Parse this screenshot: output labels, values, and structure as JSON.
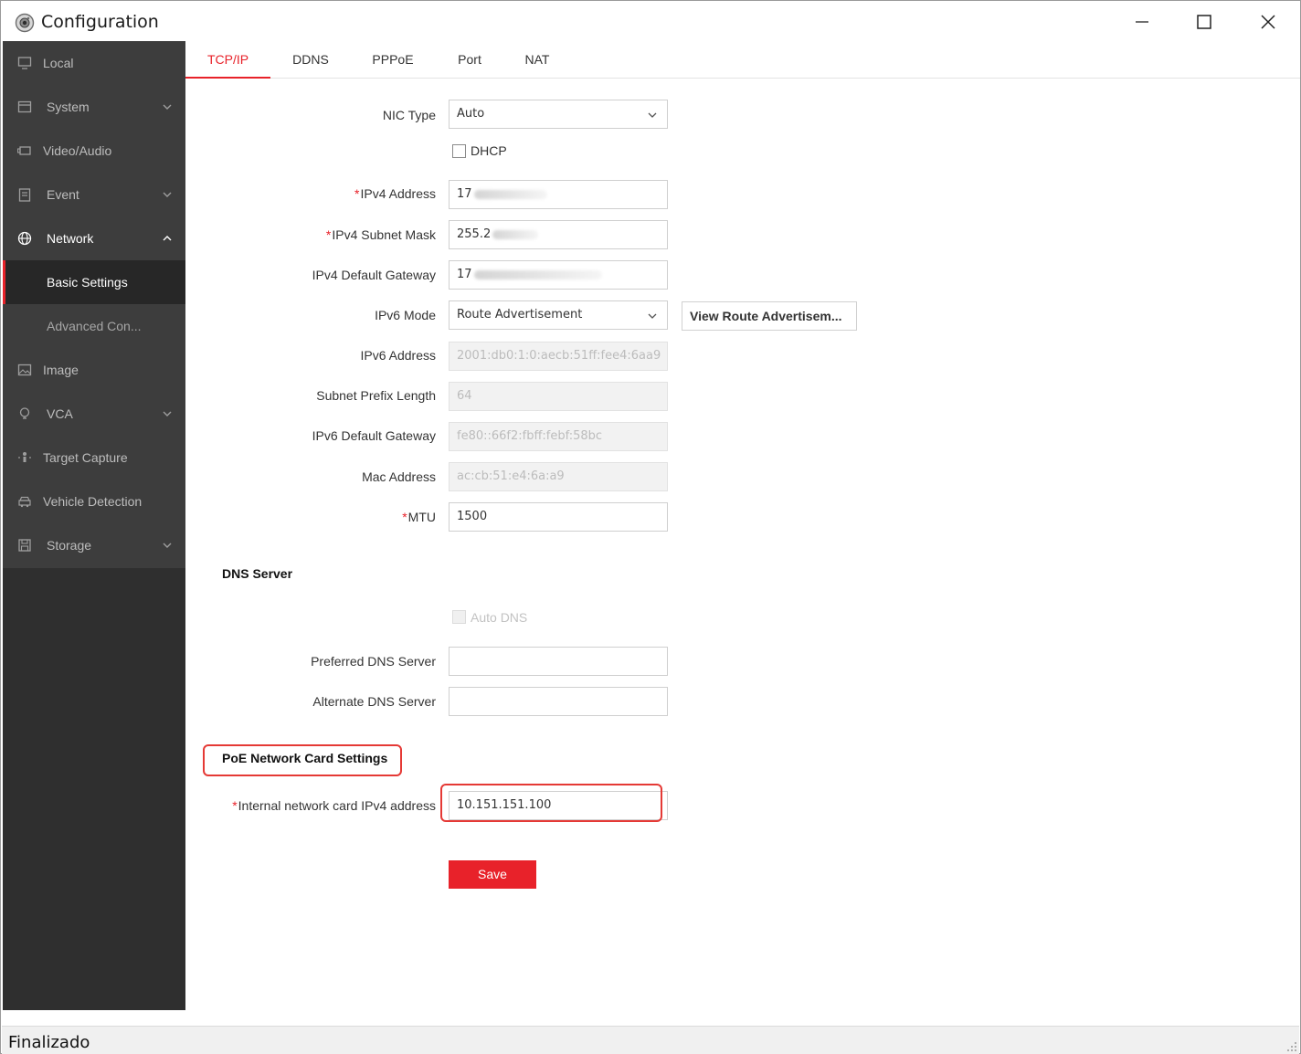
{
  "window": {
    "title": "Configuration"
  },
  "sidebar": {
    "items": [
      {
        "label": "Local",
        "icon": "monitor-icon"
      },
      {
        "label": "System",
        "icon": "system-icon"
      },
      {
        "label": "Video/Audio",
        "icon": "camera-icon"
      },
      {
        "label": "Event",
        "icon": "clipboard-icon"
      },
      {
        "label": "Network",
        "icon": "globe-icon"
      },
      {
        "label": "Image",
        "icon": "image-icon"
      },
      {
        "label": "VCA",
        "icon": "bulb-icon"
      },
      {
        "label": "Target Capture",
        "icon": "person-icon"
      },
      {
        "label": "Vehicle Detection",
        "icon": "car-icon"
      },
      {
        "label": "Storage",
        "icon": "floppy-icon"
      }
    ],
    "network_sub": [
      {
        "label": "Basic Settings"
      },
      {
        "label": "Advanced Con..."
      }
    ]
  },
  "tabs": [
    "TCP/IP",
    "DDNS",
    "PPPoE",
    "Port",
    "NAT"
  ],
  "form": {
    "nic_type": {
      "label": "NIC Type",
      "value": "Auto"
    },
    "dhcp": {
      "label": "DHCP",
      "checked": false
    },
    "ipv4_address": {
      "label": "IPv4 Address",
      "value": "17"
    },
    "ipv4_subnet": {
      "label": "IPv4 Subnet Mask",
      "value": "255.2"
    },
    "ipv4_gateway": {
      "label": "IPv4 Default Gateway",
      "value": "17"
    },
    "ipv6_mode": {
      "label": "IPv6 Mode",
      "value": "Route Advertisement"
    },
    "view_route_button": "View Route Advertisem...",
    "ipv6_address": {
      "label": "IPv6 Address",
      "value": "2001:db0:1:0:aecb:51ff:fee4:6aa9"
    },
    "subnet_prefix": {
      "label": "Subnet Prefix Length",
      "value": "64"
    },
    "ipv6_gateway": {
      "label": "IPv6 Default Gateway",
      "value": "fe80::66f2:fbff:febf:58bc"
    },
    "mac_address": {
      "label": "Mac Address",
      "value": "ac:cb:51:e4:6a:a9"
    },
    "mtu": {
      "label": "MTU",
      "value": "1500"
    }
  },
  "dns": {
    "section_title": "DNS Server",
    "auto_dns": {
      "label": "Auto DNS",
      "checked": false
    },
    "preferred": {
      "label": "Preferred DNS Server",
      "value": ""
    },
    "alternate": {
      "label": "Alternate DNS Server",
      "value": ""
    }
  },
  "poe": {
    "section_title": "PoE Network Card Settings",
    "internal_ipv4": {
      "label": "Internal network card IPv4 address",
      "value": "10.151.151.100"
    }
  },
  "save_label": "Save",
  "status": {
    "text": "Finalizado"
  },
  "colors": {
    "accent": "#e8222a",
    "sidebar_bg": "#3d3d3d",
    "annotation": "#e53935"
  }
}
